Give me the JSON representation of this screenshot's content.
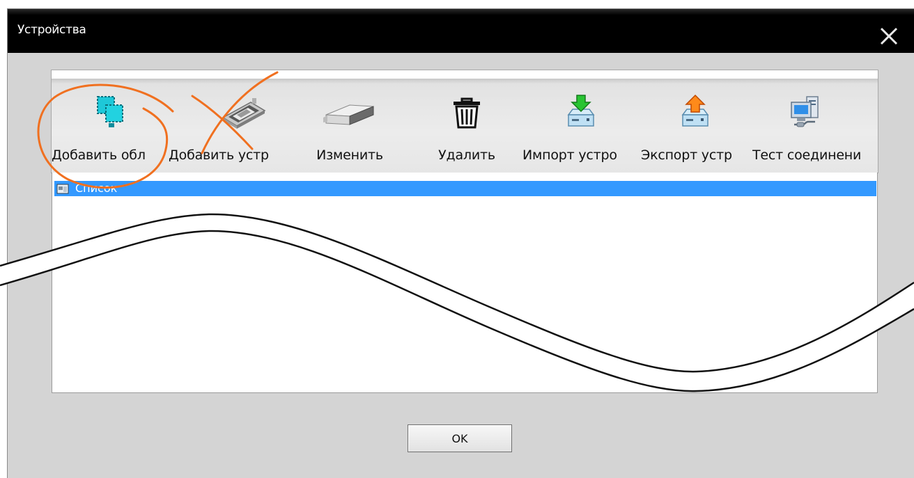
{
  "window": {
    "title": "Устройства",
    "close_icon": "close-icon"
  },
  "toolbar": {
    "buttons": [
      {
        "label": "Добавить обл",
        "icon": "add-area-icon"
      },
      {
        "label": "Добавить устр",
        "icon": "add-device-icon"
      },
      {
        "label": "Изменить",
        "icon": "modify-icon"
      },
      {
        "label": "Удалить",
        "icon": "trash-icon"
      },
      {
        "label": "Импорт устро",
        "icon": "import-icon"
      },
      {
        "label": "Экспорт устр",
        "icon": "export-icon"
      },
      {
        "label": "Тест соединени",
        "icon": "connection-test-icon"
      }
    ]
  },
  "device_list": {
    "items": [
      {
        "label": "Список",
        "selected": true,
        "icon": "list-root-icon"
      }
    ]
  },
  "footer": {
    "ok_label": "OK"
  },
  "colors": {
    "titlebar": "#000000",
    "dialog_bg": "#d4d4d4",
    "selection": "#3399ff",
    "annotation": "#f07020"
  }
}
